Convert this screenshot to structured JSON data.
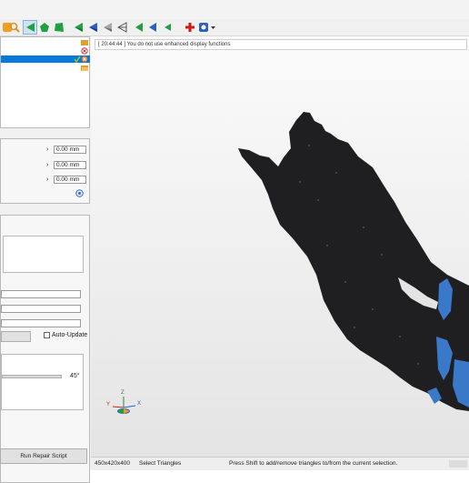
{
  "toolbar": {
    "buttons": [
      {
        "icon": "orange-square-icon",
        "color": "#f0a020"
      },
      {
        "icon": "magnifier-icon",
        "color": "#e09020"
      },
      {
        "icon": "green-triangle-select-icon",
        "color": "#20a040",
        "active": true
      },
      {
        "icon": "green-pentagon-icon",
        "color": "#20a040"
      },
      {
        "icon": "green-square-icon",
        "color": "#20a040"
      },
      {
        "icon": "green-cone-icon",
        "color": "#20a040"
      },
      {
        "icon": "blue-cone-icon",
        "color": "#2a60c0"
      },
      {
        "icon": "gray-cone-icon",
        "color": "#888888"
      },
      {
        "icon": "outline-cone-icon",
        "color": "#555555"
      },
      {
        "icon": "green-arrow-left-icon",
        "color": "#20a040"
      },
      {
        "icon": "blue-arrow-left-icon",
        "color": "#2a60c0"
      },
      {
        "icon": "green-arrow-left-small-icon",
        "color": "#20a040"
      },
      {
        "icon": "red-cross-icon",
        "color": "#d01818"
      },
      {
        "icon": "blue-gear-dropdown-icon",
        "color": "#2a60c0"
      }
    ]
  },
  "left_panel": {
    "measurements": [
      {
        "value": "0.00 mm"
      },
      {
        "value": "0.00 mm"
      },
      {
        "value": "0.00 mm"
      }
    ],
    "auto_update_label": "Auto-Update",
    "angle_label": "45°",
    "run_repair_label": "Run Repair Script"
  },
  "viewport": {
    "message": "[ 20:44:44 ] You do not use enhanced display functions",
    "axes": {
      "y": "Y",
      "z": "Z",
      "x": "X"
    }
  },
  "status": {
    "dimensions": "450x420x400",
    "mode": "Select Triangles",
    "hint": "Press Shift to add/remove triangles to/from the current selection."
  },
  "colors": {
    "selection_blue": "#0a78d7",
    "mesh_dark": "#1f1f22",
    "mesh_highlight": "#3a78c8"
  }
}
